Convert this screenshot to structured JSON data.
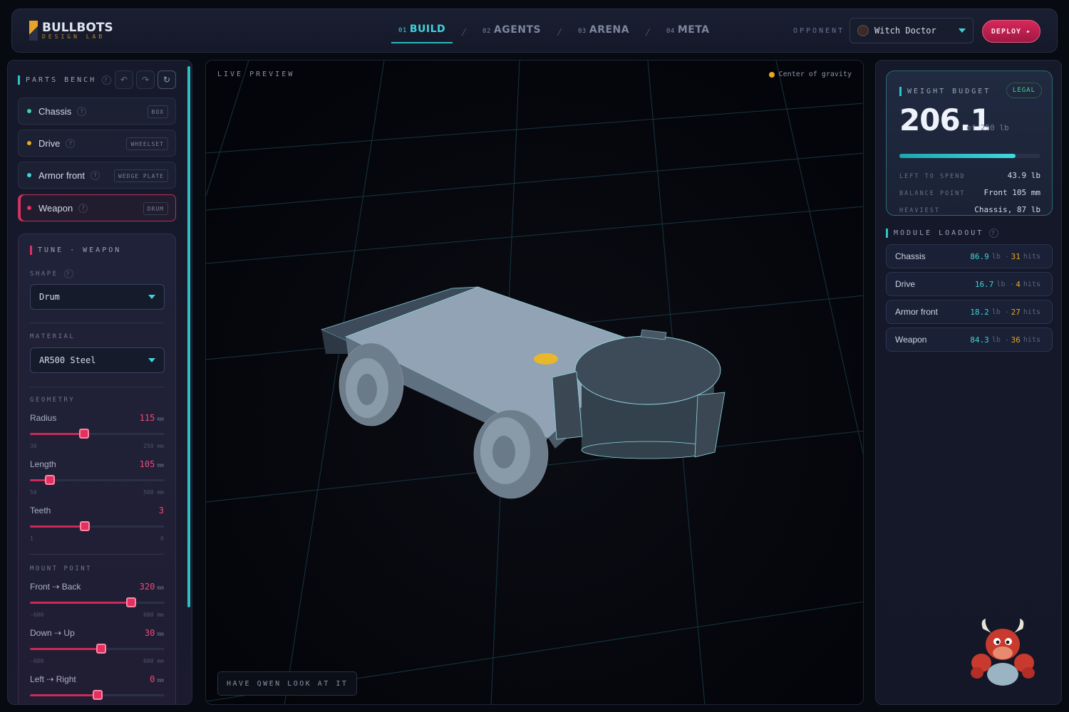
{
  "app": {
    "title": "BULLBOTS",
    "subtitle": "DESIGN LAB"
  },
  "steps": [
    {
      "num": "01",
      "label": "BUILD",
      "active": true
    },
    {
      "num": "02",
      "label": "AGENTS"
    },
    {
      "num": "03",
      "label": "ARENA"
    },
    {
      "num": "04",
      "label": "META"
    }
  ],
  "opponent": {
    "label": "OPPONENT",
    "value": "Witch Doctor"
  },
  "deploy_label": "DEPLOY ▸",
  "bench": {
    "title": "PARTS BENCH",
    "parts": [
      {
        "name": "Chassis",
        "tag": "BOX",
        "color": "#3fd3a8"
      },
      {
        "name": "Drive",
        "tag": "WHEELSET",
        "color": "#e8a824"
      },
      {
        "name": "Armor front",
        "tag": "WEDGE PLATE",
        "color": "#3fd3d8"
      },
      {
        "name": "Weapon",
        "tag": "DRUM",
        "color": "#e0315f"
      }
    ]
  },
  "tune": {
    "title": "TUNE · WEAPON",
    "shape_label": "SHAPE",
    "shape_value": "Drum",
    "material_label": "MATERIAL",
    "material_value": "AR500 Steel",
    "geometry_label": "GEOMETRY",
    "mount_label": "MOUNT POINT",
    "geometry": [
      {
        "name": "Radius",
        "value": "115",
        "unit": "mm",
        "min": "30",
        "max": "250 mm",
        "pct": 0.4
      },
      {
        "name": "Length",
        "value": "105",
        "unit": "mm",
        "min": "50",
        "max": "500 mm",
        "pct": 0.15
      },
      {
        "name": "Teeth",
        "value": "3",
        "unit": "",
        "min": "1",
        "max": "6",
        "pct": 0.41
      }
    ],
    "mount": [
      {
        "name": "Front ⇢ Back",
        "value": "320",
        "unit": "mm",
        "min": "-600",
        "max": "600 mm",
        "pct": 0.75
      },
      {
        "name": "Down ⇢ Up",
        "value": "30",
        "unit": "mm",
        "min": "-600",
        "max": "600 mm",
        "pct": 0.53
      },
      {
        "name": "Left ⇢ Right",
        "value": "0",
        "unit": "mm",
        "pct": 0.5
      }
    ]
  },
  "preview": {
    "label": "LIVE PREVIEW",
    "cog_label": "Center of gravity",
    "qwen_label": "HAVE QWEN LOOK AT IT"
  },
  "budget": {
    "title": "WEIGHT BUDGET",
    "status": "LEGAL",
    "value": "206.1",
    "of": "of 250 lb",
    "pct": 0.8244,
    "rows": [
      {
        "k": "LEFT TO SPEND",
        "v": "43.9 lb"
      },
      {
        "k": "BALANCE POINT",
        "v": "Front 105 mm"
      },
      {
        "k": "HEAVIEST",
        "v": "Chassis, 87 lb"
      }
    ]
  },
  "loadout": {
    "title": "MODULE LOADOUT",
    "modules": [
      {
        "name": "Chassis",
        "weight": "86.9",
        "hits": "31"
      },
      {
        "name": "Drive",
        "weight": "16.7",
        "hits": "4"
      },
      {
        "name": "Armor front",
        "weight": "18.2",
        "hits": "27"
      },
      {
        "name": "Weapon",
        "weight": "84.3",
        "hits": "36"
      }
    ],
    "weight_unit": "lb",
    "hits_unit": "hits"
  }
}
